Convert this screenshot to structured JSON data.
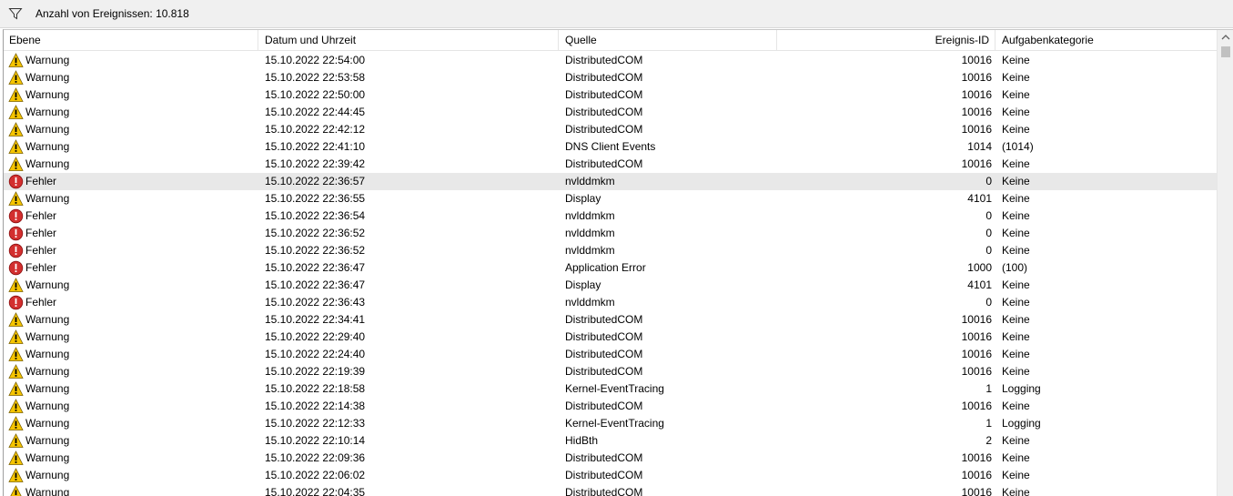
{
  "toolbar": {
    "filter_icon": "filter-funnel-icon",
    "count_text": "Anzahl von Ereignissen: 10.818"
  },
  "columns": {
    "level": "Ebene",
    "date": "Datum und Uhrzeit",
    "source": "Quelle",
    "event_id": "Ereignis-ID",
    "category": "Aufgabenkategorie"
  },
  "colors": {
    "warning": "#f5c400",
    "error": "#d32f2f",
    "selected_row": "#e8e8e8"
  },
  "rows": [
    {
      "level": "Warnung",
      "date": "15.10.2022 22:54:00",
      "source": "DistributedCOM",
      "event_id": "10016",
      "category": "Keine"
    },
    {
      "level": "Warnung",
      "date": "15.10.2022 22:53:58",
      "source": "DistributedCOM",
      "event_id": "10016",
      "category": "Keine"
    },
    {
      "level": "Warnung",
      "date": "15.10.2022 22:50:00",
      "source": "DistributedCOM",
      "event_id": "10016",
      "category": "Keine"
    },
    {
      "level": "Warnung",
      "date": "15.10.2022 22:44:45",
      "source": "DistributedCOM",
      "event_id": "10016",
      "category": "Keine"
    },
    {
      "level": "Warnung",
      "date": "15.10.2022 22:42:12",
      "source": "DistributedCOM",
      "event_id": "10016",
      "category": "Keine"
    },
    {
      "level": "Warnung",
      "date": "15.10.2022 22:41:10",
      "source": "DNS Client Events",
      "event_id": "1014",
      "category": "(1014)"
    },
    {
      "level": "Warnung",
      "date": "15.10.2022 22:39:42",
      "source": "DistributedCOM",
      "event_id": "10016",
      "category": "Keine"
    },
    {
      "level": "Fehler",
      "date": "15.10.2022 22:36:57",
      "source": "nvlddmkm",
      "event_id": "0",
      "category": "Keine",
      "selected": true
    },
    {
      "level": "Warnung",
      "date": "15.10.2022 22:36:55",
      "source": "Display",
      "event_id": "4101",
      "category": "Keine"
    },
    {
      "level": "Fehler",
      "date": "15.10.2022 22:36:54",
      "source": "nvlddmkm",
      "event_id": "0",
      "category": "Keine"
    },
    {
      "level": "Fehler",
      "date": "15.10.2022 22:36:52",
      "source": "nvlddmkm",
      "event_id": "0",
      "category": "Keine"
    },
    {
      "level": "Fehler",
      "date": "15.10.2022 22:36:52",
      "source": "nvlddmkm",
      "event_id": "0",
      "category": "Keine"
    },
    {
      "level": "Fehler",
      "date": "15.10.2022 22:36:47",
      "source": "Application Error",
      "event_id": "1000",
      "category": "(100)"
    },
    {
      "level": "Warnung",
      "date": "15.10.2022 22:36:47",
      "source": "Display",
      "event_id": "4101",
      "category": "Keine"
    },
    {
      "level": "Fehler",
      "date": "15.10.2022 22:36:43",
      "source": "nvlddmkm",
      "event_id": "0",
      "category": "Keine"
    },
    {
      "level": "Warnung",
      "date": "15.10.2022 22:34:41",
      "source": "DistributedCOM",
      "event_id": "10016",
      "category": "Keine"
    },
    {
      "level": "Warnung",
      "date": "15.10.2022 22:29:40",
      "source": "DistributedCOM",
      "event_id": "10016",
      "category": "Keine"
    },
    {
      "level": "Warnung",
      "date": "15.10.2022 22:24:40",
      "source": "DistributedCOM",
      "event_id": "10016",
      "category": "Keine"
    },
    {
      "level": "Warnung",
      "date": "15.10.2022 22:19:39",
      "source": "DistributedCOM",
      "event_id": "10016",
      "category": "Keine"
    },
    {
      "level": "Warnung",
      "date": "15.10.2022 22:18:58",
      "source": "Kernel-EventTracing",
      "event_id": "1",
      "category": "Logging"
    },
    {
      "level": "Warnung",
      "date": "15.10.2022 22:14:38",
      "source": "DistributedCOM",
      "event_id": "10016",
      "category": "Keine"
    },
    {
      "level": "Warnung",
      "date": "15.10.2022 22:12:33",
      "source": "Kernel-EventTracing",
      "event_id": "1",
      "category": "Logging"
    },
    {
      "level": "Warnung",
      "date": "15.10.2022 22:10:14",
      "source": "HidBth",
      "event_id": "2",
      "category": "Keine"
    },
    {
      "level": "Warnung",
      "date": "15.10.2022 22:09:36",
      "source": "DistributedCOM",
      "event_id": "10016",
      "category": "Keine"
    },
    {
      "level": "Warnung",
      "date": "15.10.2022 22:06:02",
      "source": "DistributedCOM",
      "event_id": "10016",
      "category": "Keine"
    },
    {
      "level": "Warnung",
      "date": "15.10.2022 22:04:35",
      "source": "DistributedCOM",
      "event_id": "10016",
      "category": "Keine"
    }
  ]
}
